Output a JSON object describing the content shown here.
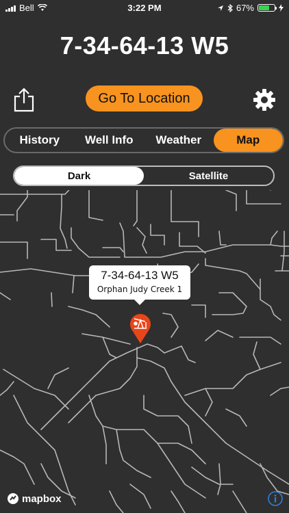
{
  "status_bar": {
    "carrier": "Bell",
    "time": "3:22 PM",
    "battery_percent": "67%",
    "battery_level": 0.67,
    "battery_color": "#39d353"
  },
  "header": {
    "well_title": "7-34-64-13 W5"
  },
  "toolbar": {
    "share_icon": "share-icon",
    "go_to_location_label": "Go To Location",
    "settings_icon": "gear-icon",
    "accent_color": "#f7931e"
  },
  "tabs": [
    {
      "label": "History",
      "active": false
    },
    {
      "label": "Well Info",
      "active": false
    },
    {
      "label": "Weather",
      "active": false
    },
    {
      "label": "Map",
      "active": true
    }
  ],
  "map_type": {
    "options": [
      {
        "label": "Dark",
        "active": true
      },
      {
        "label": "Satellite",
        "active": false
      }
    ]
  },
  "map": {
    "background_color": "#2f2f2f",
    "road_color": "#b8b8b8",
    "marker": {
      "title": "7-34-64-13 W5",
      "subtitle": "Orphan Judy Creek 1",
      "icon": "pump-jack-icon",
      "color": "#e8461a"
    },
    "attribution": "mapbox",
    "info_icon": "info-icon"
  }
}
